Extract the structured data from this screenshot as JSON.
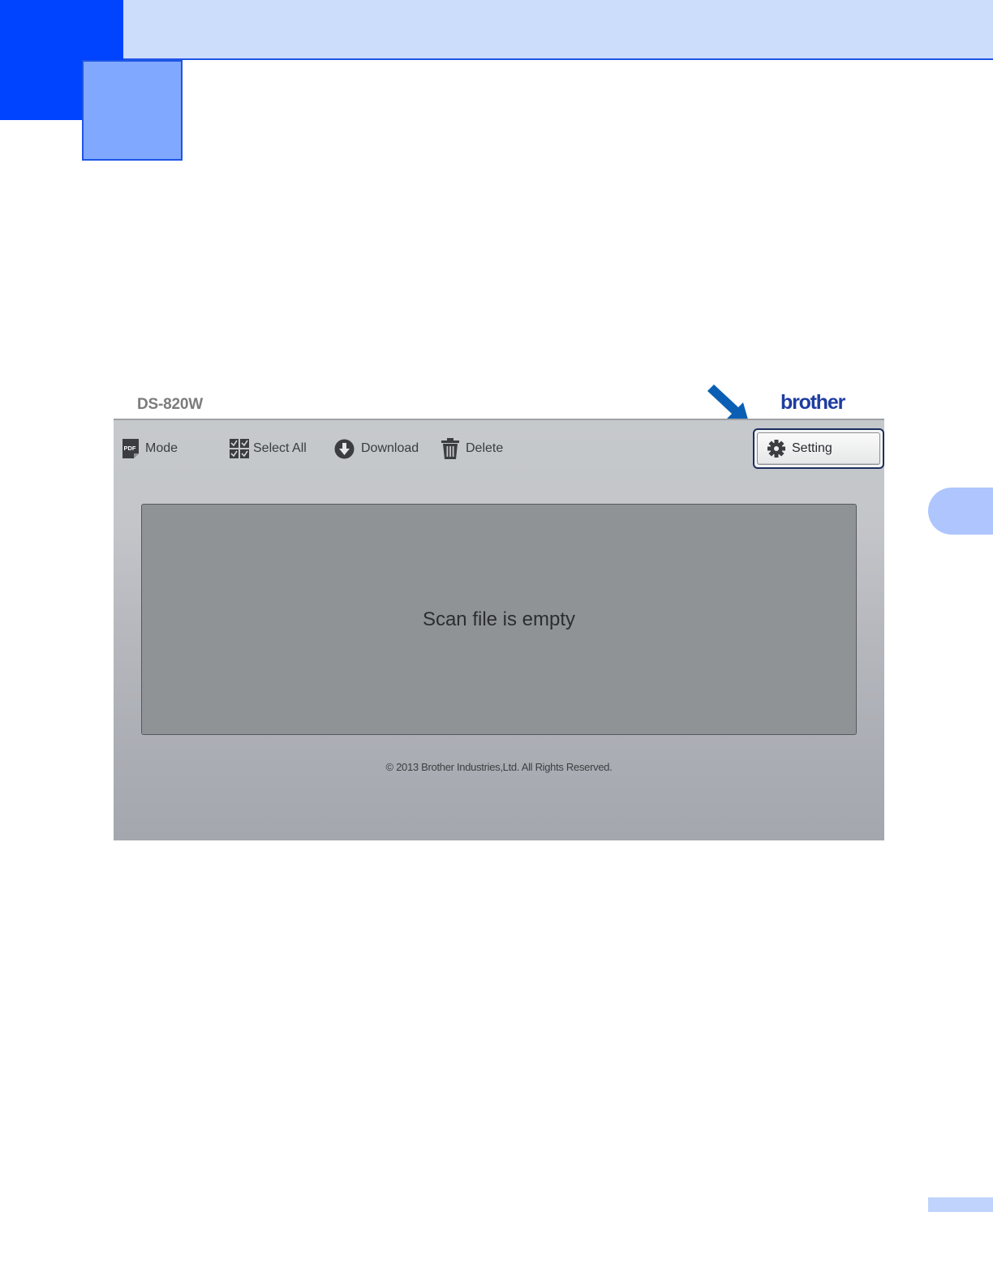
{
  "page": {
    "accent_color": "#0044ff",
    "band_color": "#ccdcfb",
    "tab_color": "#80a8ff"
  },
  "screen": {
    "model_name": "DS-820W",
    "brand_logo": "brother",
    "toolbar": {
      "mode": {
        "label": "Mode",
        "icon": "pdf-icon"
      },
      "select_all": {
        "label": "Select All",
        "icon": "checkbox-grid-icon"
      },
      "download": {
        "label": "Download",
        "icon": "download-arrow-icon"
      },
      "delete": {
        "label": "Delete",
        "icon": "trash-icon"
      },
      "setting": {
        "label": "Setting",
        "icon": "gear-icon"
      }
    },
    "scan_area": {
      "empty_message": "Scan file is empty"
    },
    "footer": {
      "copyright": "© 2013 Brother Industries,Ltd. All Rights Reserved."
    },
    "highlight": {
      "arrow_color": "#0a5fb4",
      "target": "Setting"
    }
  }
}
